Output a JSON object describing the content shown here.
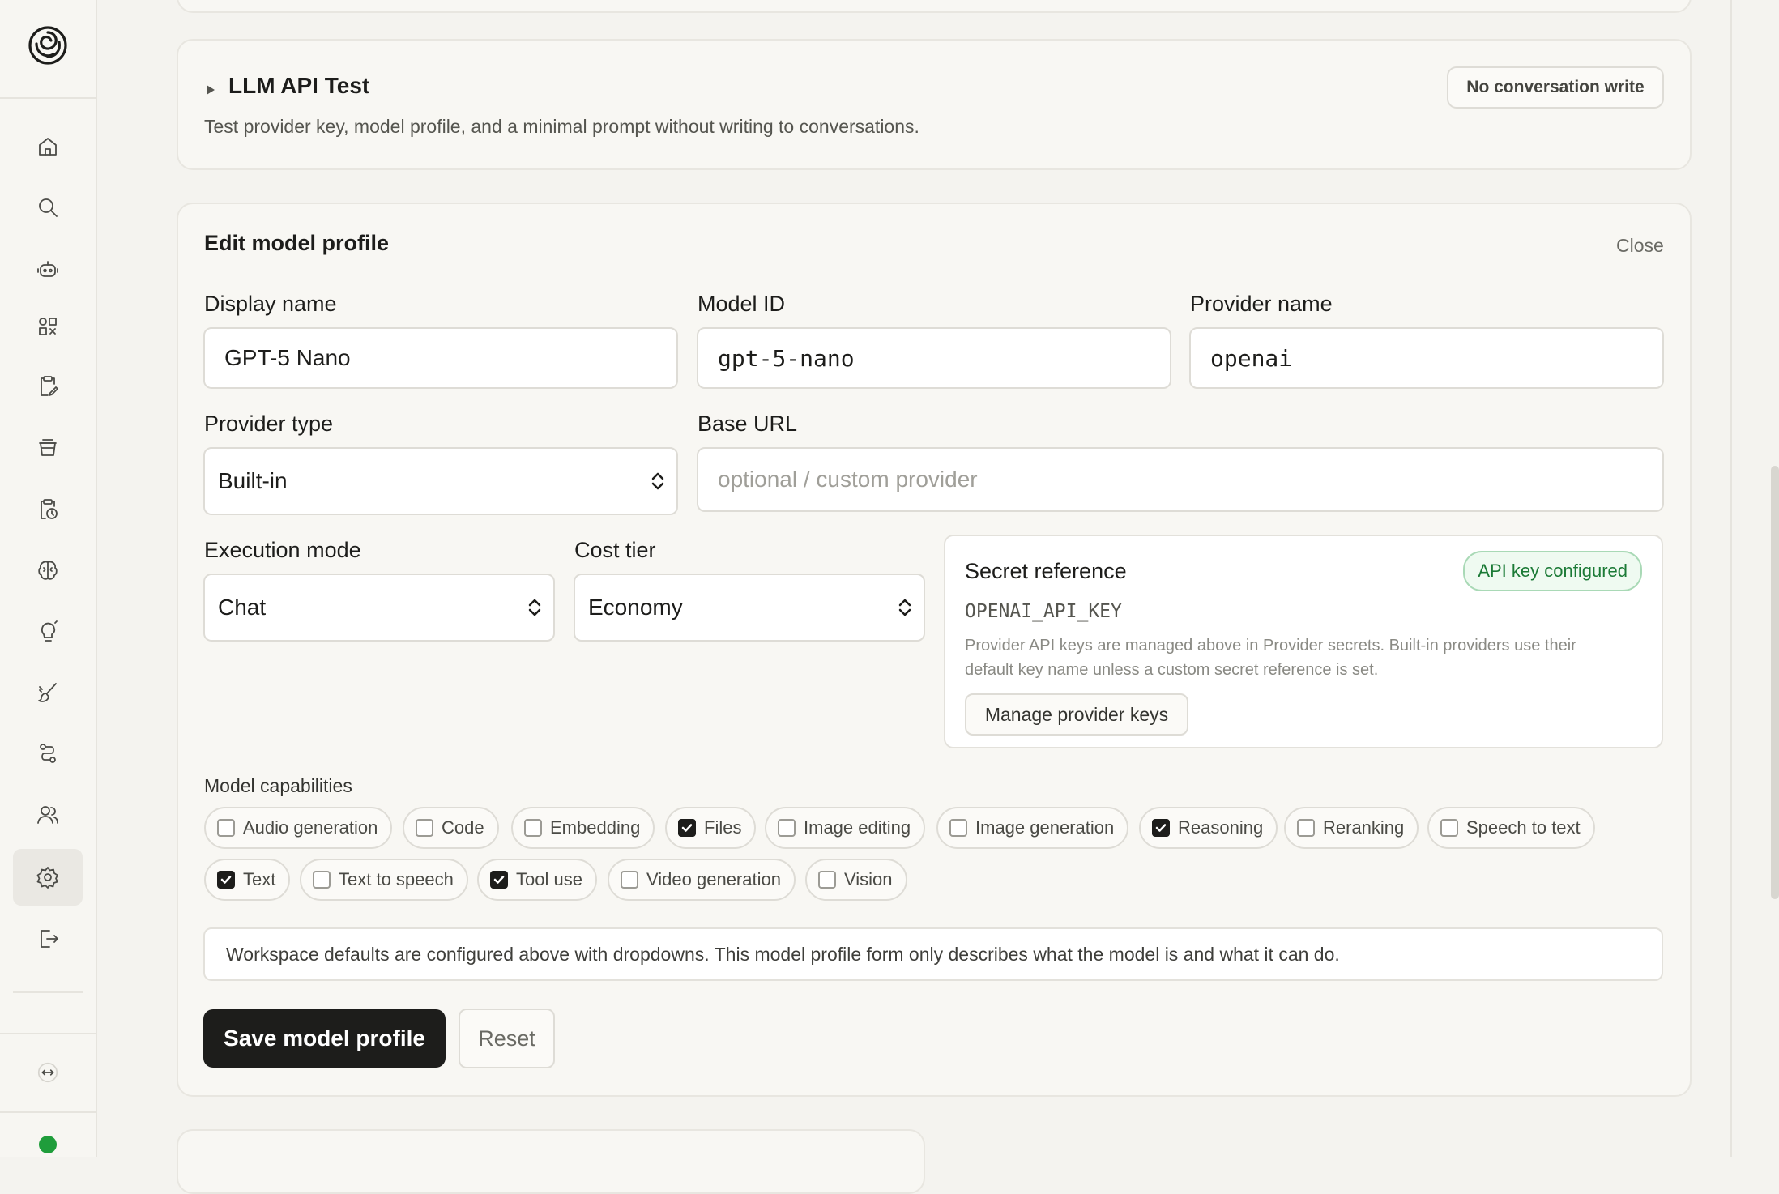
{
  "sidebar": {
    "logo_icon": "spiral-logo-icon",
    "nav": [
      {
        "name": "home",
        "icon": "home-icon"
      },
      {
        "name": "search",
        "icon": "search-icon"
      },
      {
        "name": "agents",
        "icon": "robot-icon"
      },
      {
        "name": "apps",
        "icon": "grid-shapes-icon"
      },
      {
        "name": "notes",
        "icon": "clipboard-edit-icon"
      },
      {
        "name": "storage",
        "icon": "stack-icon"
      },
      {
        "name": "history",
        "icon": "clipboard-clock-icon"
      },
      {
        "name": "knowledge",
        "icon": "brain-icon"
      },
      {
        "name": "ideas",
        "icon": "lightbulb-icon"
      },
      {
        "name": "skills",
        "icon": "brush-icon"
      },
      {
        "name": "workflows",
        "icon": "workflow-icon"
      },
      {
        "name": "team",
        "icon": "users-icon"
      },
      {
        "name": "settings",
        "icon": "gear-icon",
        "active": true
      },
      {
        "name": "logout",
        "icon": "logout-icon"
      }
    ],
    "expand_icon": "expand-arrows-icon",
    "status_color": "#1f9d3b"
  },
  "llm_test": {
    "title": "LLM API Test",
    "description": "Test provider key, model profile, and a minimal prompt without writing to conversations.",
    "badge": "No conversation write"
  },
  "edit_profile": {
    "title": "Edit model profile",
    "close_label": "Close",
    "fields": {
      "display_name": {
        "label": "Display name",
        "value": "GPT-5 Nano"
      },
      "model_id": {
        "label": "Model ID",
        "value": "gpt-5-nano"
      },
      "provider_name": {
        "label": "Provider name",
        "value": "openai"
      },
      "provider_type": {
        "label": "Provider type",
        "value": "Built-in"
      },
      "base_url": {
        "label": "Base URL",
        "value": "",
        "placeholder": "optional / custom provider"
      },
      "execution_mode": {
        "label": "Execution mode",
        "value": "Chat"
      },
      "cost_tier": {
        "label": "Cost tier",
        "value": "Economy"
      }
    },
    "secret": {
      "title": "Secret reference",
      "badge": "API key configured",
      "key_name": "OPENAI_API_KEY",
      "help_line1": "Provider API keys are managed above in Provider secrets. Built-in providers use their",
      "help_line2": "default key name unless a custom secret reference is set.",
      "manage_button": "Manage provider keys"
    },
    "capabilities": {
      "label": "Model capabilities",
      "items": [
        {
          "label": "Audio generation",
          "checked": false
        },
        {
          "label": "Code",
          "checked": false
        },
        {
          "label": "Embedding",
          "checked": false
        },
        {
          "label": "Files",
          "checked": true
        },
        {
          "label": "Image editing",
          "checked": false
        },
        {
          "label": "Image generation",
          "checked": false
        },
        {
          "label": "Reasoning",
          "checked": true
        },
        {
          "label": "Reranking",
          "checked": false
        },
        {
          "label": "Speech to text",
          "checked": false
        },
        {
          "label": "Text",
          "checked": true
        },
        {
          "label": "Text to speech",
          "checked": false
        },
        {
          "label": "Tool use",
          "checked": true
        },
        {
          "label": "Video generation",
          "checked": false
        },
        {
          "label": "Vision",
          "checked": false
        }
      ]
    },
    "note": "Workspace defaults are configured above with dropdowns. This model profile form only describes what the model is and what it can do.",
    "save_button": "Save model profile",
    "reset_button": "Reset"
  }
}
